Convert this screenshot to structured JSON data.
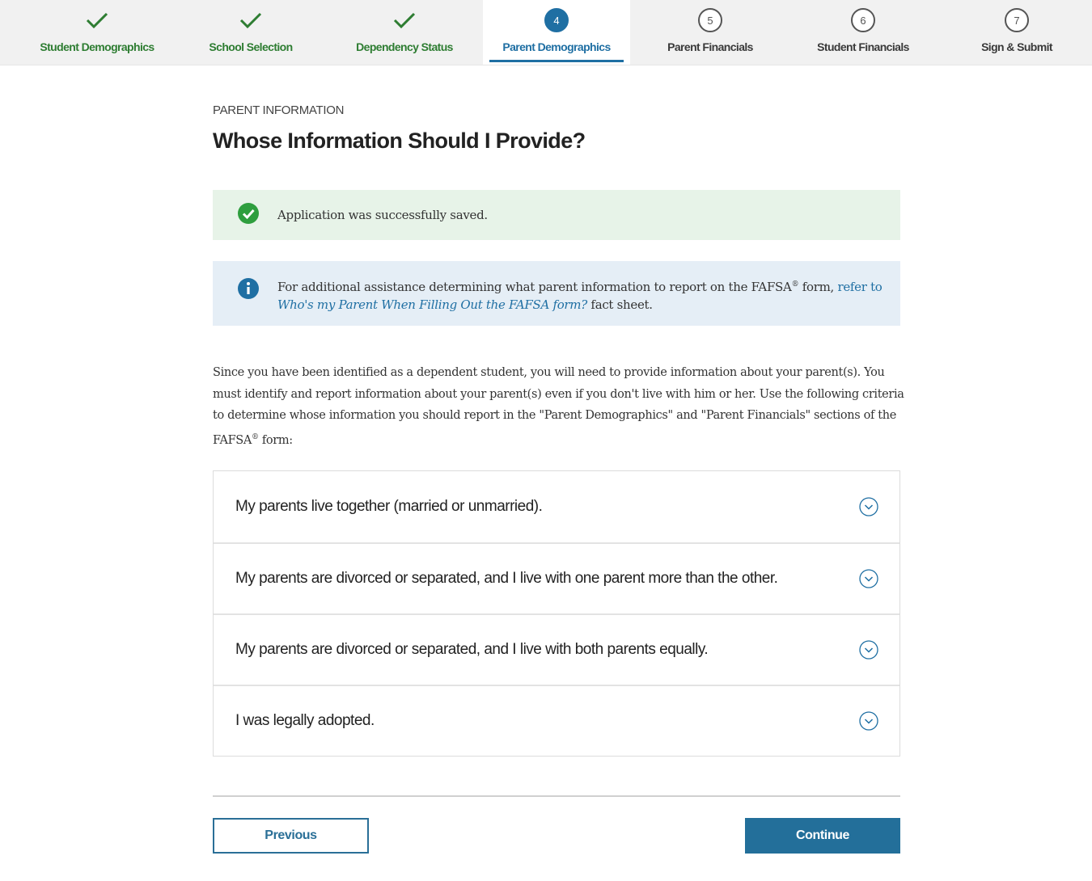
{
  "stepper": {
    "steps": [
      {
        "label": "Student Demographics",
        "status": "complete",
        "number": ""
      },
      {
        "label": "School Selection",
        "status": "complete",
        "number": ""
      },
      {
        "label": "Dependency Status",
        "status": "complete",
        "number": ""
      },
      {
        "label": "Parent Demographics",
        "status": "current",
        "number": "4"
      },
      {
        "label": "Parent Financials",
        "status": "upcoming",
        "number": "5"
      },
      {
        "label": "Student Financials",
        "status": "upcoming",
        "number": "6"
      },
      {
        "label": "Sign & Submit",
        "status": "upcoming",
        "number": "7"
      }
    ]
  },
  "page": {
    "eyebrow": "PARENT INFORMATION",
    "title": "Whose Information Should I Provide?"
  },
  "alerts": {
    "success": {
      "icon": "check-circle-icon",
      "text": "Application was successfully saved."
    },
    "info": {
      "icon": "info-icon",
      "text_before": "For additional assistance determining what parent information to report on the FAFSA",
      "text_sup": "®",
      "text_mid": " form, ",
      "link_prefix": "refer to ",
      "link_text": "Who's my Parent When Filling Out the FAFSA form?",
      "text_after": " fact sheet."
    }
  },
  "instructions": {
    "text": "Since you have been identified as a dependent student, you will need to provide information about your parent(s). You must identify and report information about your parent(s) even if you don't live with him or her. Use the following criteria to determine whose information you should report in the \"Parent Demographics\" and \"Parent Financials\" sections of the FAFSA",
    "sup": "®",
    "text_end": " form:"
  },
  "accordion": {
    "items": [
      {
        "label": "My parents live together (married or unmarried)."
      },
      {
        "label": "My parents are divorced or separated, and I live with one parent more than the other."
      },
      {
        "label": "My parents are divorced or separated, and I live with both parents equally."
      },
      {
        "label": "I was legally adopted."
      }
    ]
  },
  "buttons": {
    "previous": "Previous",
    "continue": "Continue"
  },
  "colors": {
    "complete": "#2e7d32",
    "primary": "#1f6fa3",
    "success_bg": "#e7f3e8",
    "info_bg": "#e5eef6"
  }
}
